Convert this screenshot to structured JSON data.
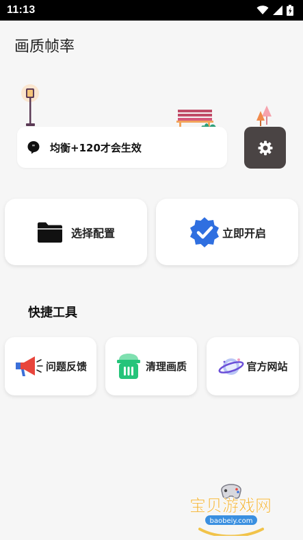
{
  "status_bar": {
    "time": "11:13"
  },
  "app": {
    "title": "画质帧率"
  },
  "notice": {
    "text": "均衡+120才会生效"
  },
  "actions": {
    "select_config": "选择配置",
    "start_now": "立即开启"
  },
  "tools": {
    "section_title": "快捷工具",
    "items": [
      {
        "label": "问题反馈",
        "icon": "megaphone-icon"
      },
      {
        "label": "清理画质",
        "icon": "trash-icon"
      },
      {
        "label": "官方网站",
        "icon": "planet-icon"
      }
    ]
  },
  "watermark": {
    "title": "宝贝游戏网",
    "url": "baobeiy.com"
  },
  "colors": {
    "background": "#f6f6f6",
    "settings_button": "#4a4444",
    "verified_blue": "#2f6fe0",
    "clean_green": "#25c47a",
    "feedback_red": "#e8453c"
  }
}
